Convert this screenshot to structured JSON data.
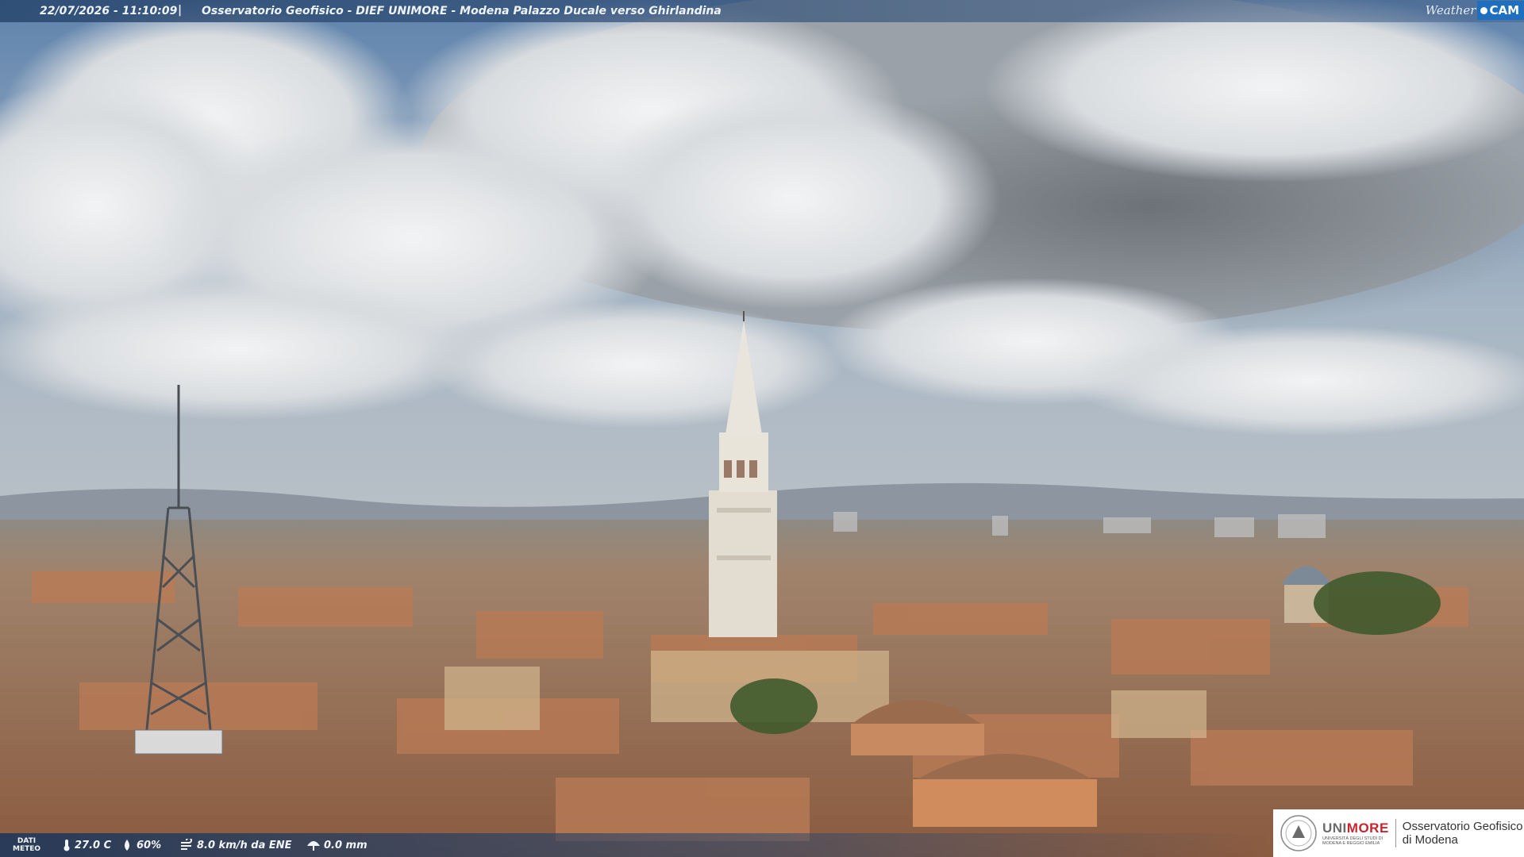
{
  "overlay": {
    "timestamp": "22/07/2026 - 11:10:09",
    "separator": "|",
    "title": "Osservatorio Geofisico - DIEF UNIMORE - Modena Palazzo Ducale verso Ghirlandina",
    "brand_weather": "Weather",
    "brand_cam": "CAM"
  },
  "meteo": {
    "label_line1": "DATI",
    "label_line2": "METEO",
    "temperature": "27.0 C",
    "humidity": "60%",
    "wind": "8.0 km/h da ENE",
    "rain": "0.0 mm"
  },
  "logo": {
    "uni_part1": "UNI",
    "uni_part2": "MORE",
    "uni_sub1": "UNIVERSITÀ DEGLI STUDI DI",
    "uni_sub2": "MODENA E REGGIO EMILIA",
    "observatory_line1": "Osservatorio Geofisico",
    "observatory_line2": "di Modena"
  },
  "colors": {
    "sky": "#6f8fb3",
    "cloud": "#e6e8ea",
    "roof": "#a86a48",
    "tower": "#e7e1d6",
    "brand_blue": "#1f6fc0",
    "unimore_red": "#c5262e"
  }
}
